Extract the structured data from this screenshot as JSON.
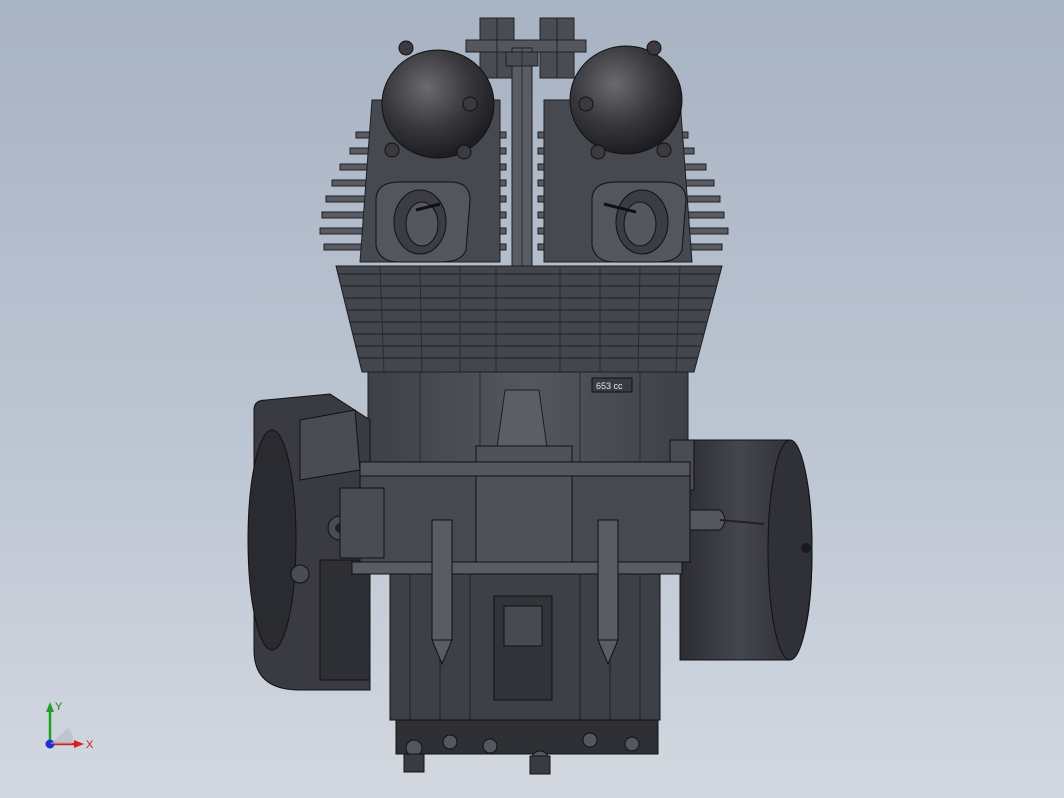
{
  "viewport": {
    "background_top": "#a8b3c3",
    "background_bottom": "#d3d8e0"
  },
  "model": {
    "displacement_label": "653 cc",
    "body_color": "#4d4f57",
    "dark_color": "#2f3036",
    "cover_color": "#37383f"
  },
  "triad": {
    "x_label": "X",
    "y_label": "Y",
    "x_color": "#d62020",
    "y_color": "#22a022",
    "z_color": "#2030d0"
  }
}
